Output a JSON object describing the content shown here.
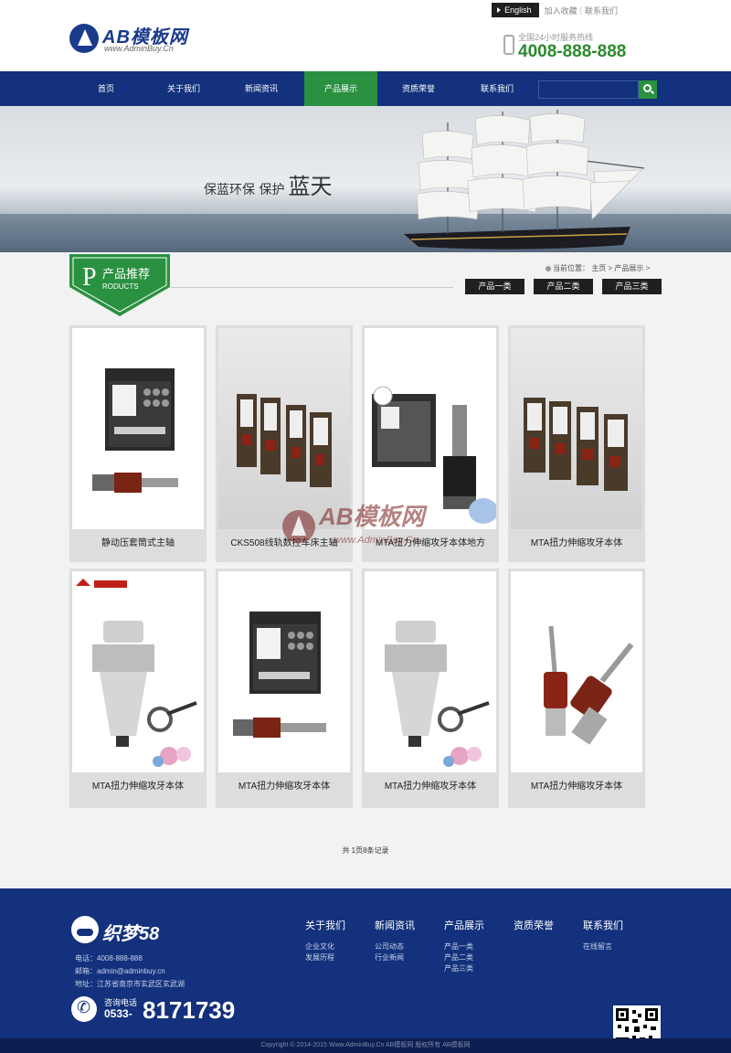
{
  "header": {
    "logo_text": "AB模板网",
    "logo_sub": "www.AdminBuy.Cn",
    "lang_label": "English",
    "fav_link": "加入收藏",
    "contact_link": "联系我们",
    "hotline_label": "全国24小时服务热线",
    "hotline_number": "4008-888-888"
  },
  "nav": {
    "items": [
      {
        "label": "首页"
      },
      {
        "label": "关于我们"
      },
      {
        "label": "新闻资讯"
      },
      {
        "label": "产品展示"
      },
      {
        "label": "资质荣誉"
      },
      {
        "label": "联系我们"
      }
    ],
    "active_index": 3,
    "search_placeholder": ""
  },
  "banner": {
    "slogan_small": "保蓝环保  保护",
    "slogan_big": "蓝天"
  },
  "section": {
    "letter": "P",
    "title": "产品推荐",
    "sub": "RODUCTS",
    "breadcrumb_prefix": "当前位置：",
    "breadcrumb_home": "主页",
    "breadcrumb_current": "产品展示",
    "categories": [
      "产品一类",
      "产品二类",
      "产品三类"
    ]
  },
  "products": [
    {
      "name": "静动压套筒式主轴",
      "image": "toolbox-kit"
    },
    {
      "name": "CKS508线轨数控车床主轴",
      "image": "boxes-kit"
    },
    {
      "name": "MTA扭力伸缩攻牙本体地方",
      "image": "case-chuck"
    },
    {
      "name": "MTA扭力伸缩攻牙本体",
      "image": "boxes-kit"
    },
    {
      "name": "MTA扭力伸缩攻牙本体",
      "image": "holder-flower"
    },
    {
      "name": "MTA扭力伸缩攻牙本体",
      "image": "toolbox-kit"
    },
    {
      "name": "MTA扭力伸缩攻牙本体",
      "image": "holder-flower"
    },
    {
      "name": "MTA扭力伸缩攻牙本体",
      "image": "tapping-head"
    }
  ],
  "pager": {
    "text": "共 1页8条记录"
  },
  "watermark": {
    "text": "AB模板网",
    "sub": "www.AdminBuy.Cn"
  },
  "footer": {
    "logo_text": "织梦58",
    "info": [
      "电话：4008-888-888",
      "邮箱：admin@adminbuy.cn",
      "地址：江苏省南京市玄武区玄武湖"
    ],
    "phone_label": "咨询电话",
    "phone_prefix": "0533-",
    "phone_number": "8171739",
    "columns": [
      {
        "title": "关于我们",
        "links": [
          "企业文化",
          "发展历程"
        ]
      },
      {
        "title": "新闻资讯",
        "links": [
          "公司动态",
          "行业新闻"
        ]
      },
      {
        "title": "产品展示",
        "links": [
          "产品一类",
          "产品二类",
          "产品三类"
        ]
      },
      {
        "title": "资质荣誉",
        "links": []
      },
      {
        "title": "联系我们",
        "links": [
          "在线留言"
        ]
      }
    ],
    "copyright": "Copyright © 2014-2015 Www.AdminBuy.Cn AB模板网 版权所有  AB模板网"
  },
  "colors": {
    "primary": "#13317c",
    "accent": "#2a9140",
    "hotline": "#2c8a2c"
  }
}
